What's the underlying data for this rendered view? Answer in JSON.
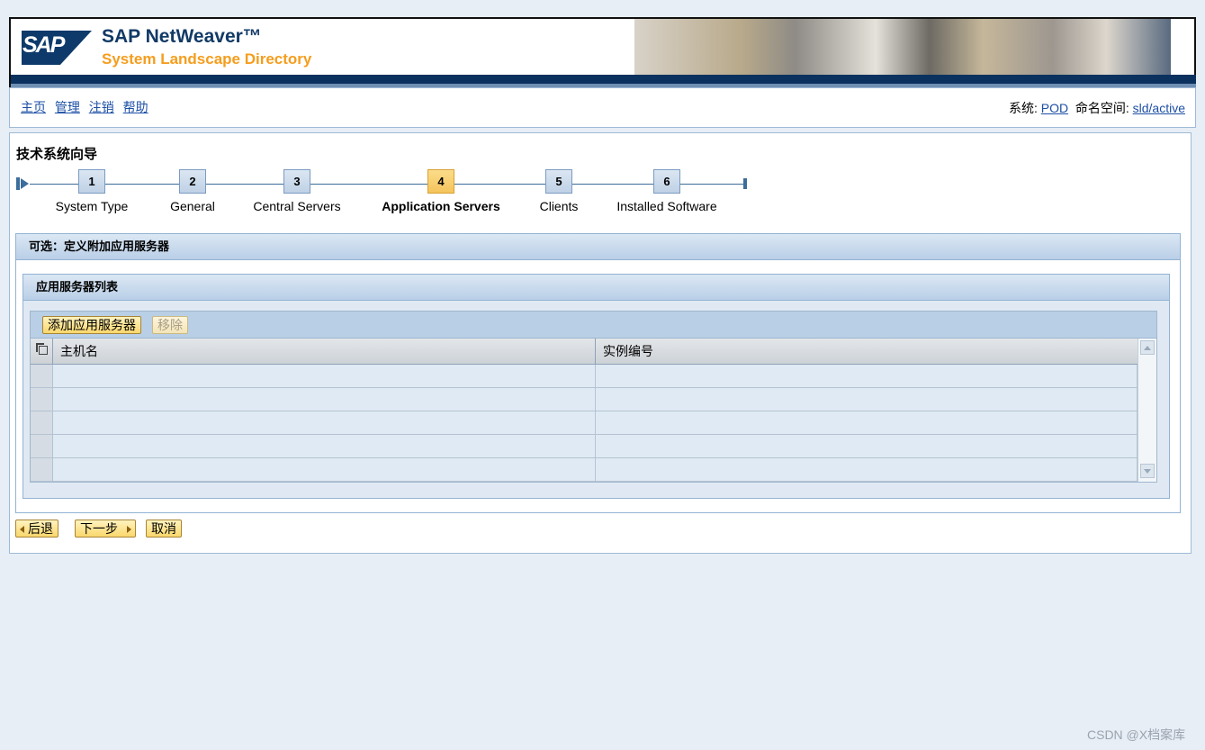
{
  "header": {
    "logo_text": "SAP",
    "product": "SAP NetWeaver™",
    "subtitle": "System Landscape Directory"
  },
  "nav": {
    "links": [
      "主页",
      "管理",
      "注销",
      "帮助"
    ],
    "system_label": "系统:",
    "system_value": "POD",
    "namespace_label": "命名空间:",
    "namespace_value": "sld/active"
  },
  "wizard": {
    "title": "技术系统向导",
    "current_step": 4,
    "steps": [
      {
        "num": "1",
        "label": "System Type"
      },
      {
        "num": "2",
        "label": "General"
      },
      {
        "num": "3",
        "label": "Central Servers"
      },
      {
        "num": "4",
        "label": "Application Servers"
      },
      {
        "num": "5",
        "label": "Clients"
      },
      {
        "num": "6",
        "label": "Installed Software"
      }
    ]
  },
  "section": {
    "title": "可选：定义附加应用服务器",
    "list_title": "应用服务器列表",
    "add_button": "添加应用服务器",
    "remove_button": "移除",
    "columns": [
      "主机名",
      "实例编号"
    ],
    "rows": [
      [
        "",
        ""
      ],
      [
        "",
        ""
      ],
      [
        "",
        ""
      ],
      [
        "",
        ""
      ],
      [
        "",
        ""
      ]
    ]
  },
  "footer": {
    "back_button": "后退",
    "next_button": "下一步",
    "cancel_button": "取消"
  },
  "watermark": "CSDN @X档案库",
  "colors": {
    "accent": "#f5c45c",
    "brand_dark": "#0b325f",
    "subtitle": "#f59d1d"
  }
}
